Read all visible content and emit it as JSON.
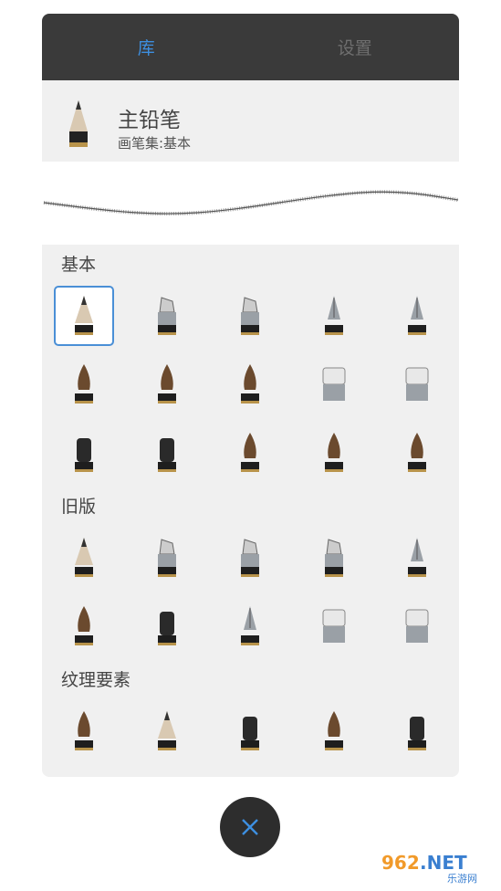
{
  "tabs": [
    {
      "label": "库",
      "active": true
    },
    {
      "label": "设置",
      "active": false
    }
  ],
  "current_brush": {
    "name": "主铅笔",
    "set_label": "画笔集:基本"
  },
  "sections": [
    {
      "title": "基本",
      "rows": [
        [
          "pencil",
          "chisel-marker",
          "marker",
          "ballpoint",
          "fountain-pen"
        ],
        [
          "round-brush",
          "ink-brush",
          "airbrush",
          "eraser",
          "hard-eraser"
        ],
        [
          "flat-tip",
          "rough-tip",
          "bristle-brush",
          "fan-brush",
          "dry-brush"
        ]
      ]
    },
    {
      "title": "旧版",
      "rows": [
        [
          "legacy-pencil",
          "legacy-marker",
          "legacy-chisel",
          "legacy-felt",
          "legacy-pen"
        ],
        [
          "legacy-brush",
          "legacy-ink",
          "legacy-nib",
          "legacy-eraser",
          "legacy-soft-eraser"
        ]
      ]
    },
    {
      "title": "纹理要素",
      "rows": [
        [
          "texture-brush-1",
          "texture-pencil",
          "texture-block",
          "texture-bristle",
          "texture-stamp"
        ]
      ]
    }
  ],
  "selected_brush": "pencil",
  "watermark": {
    "text": "962.NET",
    "subtext": "乐游网"
  },
  "colors": {
    "accent": "#3d8fe0",
    "tabbar": "#3a3a3a",
    "panel": "#f0f0f0"
  }
}
